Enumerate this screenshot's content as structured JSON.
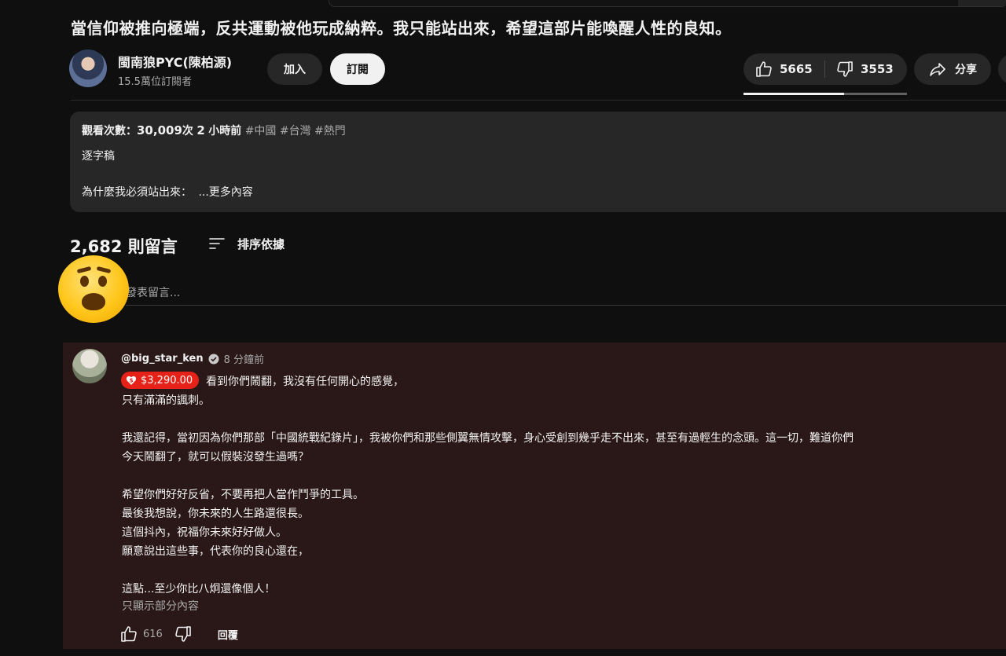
{
  "video": {
    "title": "當信仰被推向極端，反共運動被他玩成納粹。我只能站出來，希望這部片能喚醒人性的良知。"
  },
  "channel": {
    "name": "閩南狼PYC(陳柏源)",
    "subscribers": "15.5萬位訂閱者",
    "join_label": "加入",
    "subscribe_label": "訂閱"
  },
  "actions": {
    "likes": "5665",
    "dislikes": "3553",
    "share_label": "分享",
    "like_ratio": 0.615
  },
  "description": {
    "views_label": "觀看次數：",
    "views_value": "30,009",
    "views_unit": "次",
    "time_num": "2",
    "time_unit": "小時前",
    "tags": "#中國 #台灣 #熱門",
    "line2": "逐字稿",
    "line3_text": "為什麼我必須站出來：",
    "more_label": "...更多內容"
  },
  "comments": {
    "count_num": "2,682",
    "count_label": "則留言",
    "sort_label": "排序依據",
    "add_placeholder": "發表留言..."
  },
  "comment": {
    "username": "@big_star_ken",
    "time": "8 分鐘前",
    "super_thanks": "$3,290.00",
    "first_line": "看到你們鬧翻，我沒有任何開心的感覺，",
    "body": "只有滿滿的諷刺。\n\n我還記得，當初因為你們那部「中國統戰紀錄片」，我被你們和那些側翼無情攻擊，身心受創到幾乎走不出來，甚至有過輕生的念頭。這一切，難道你們\n今天鬧翻了，就可以假裝沒發生過嗎？\n\n希望你們好好反省，不要再把人當作鬥爭的工具。\n最後我想說，你未來的人生路還很長。\n這個抖內，祝福你未來好好做人。\n願意說出這些事，代表你的良心還在，\n\n這點...至少你比八炯還像個人！",
    "read_more": "只顯示部分內容",
    "likes": "616",
    "reply_label": "回覆"
  },
  "colors": {
    "background": "#0f0f0f",
    "surface": "#272727",
    "comment_highlight": "#2a1818",
    "super_thanks": "#e62117"
  }
}
